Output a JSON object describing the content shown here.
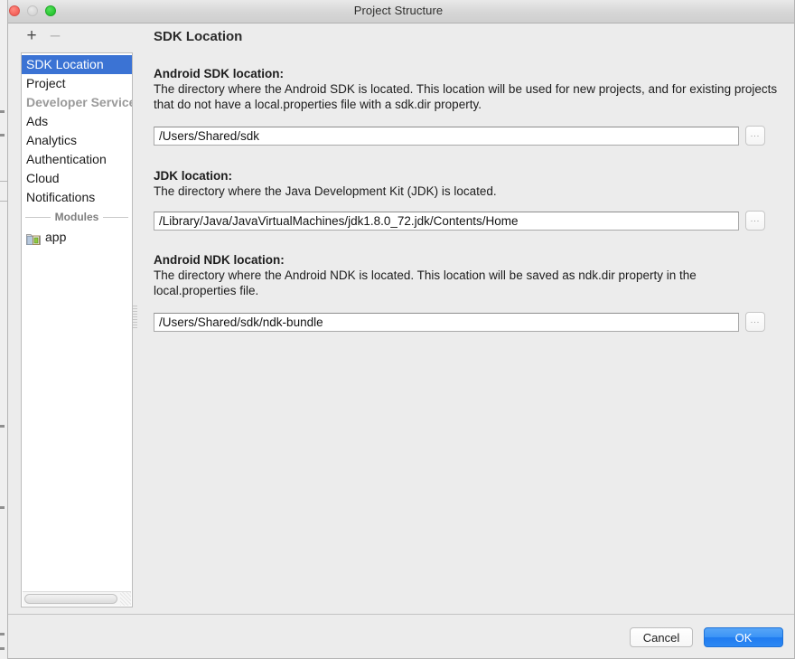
{
  "window": {
    "title": "Project Structure",
    "traffic_lights": [
      "close",
      "minimize",
      "zoom"
    ]
  },
  "sidebar": {
    "toolbar": {
      "add_label": "+",
      "remove_label": "–"
    },
    "items": [
      {
        "label": "SDK Location",
        "state": "selected"
      },
      {
        "label": "Project",
        "state": "normal"
      },
      {
        "label": "Developer Services",
        "state": "muted"
      },
      {
        "label": "Ads",
        "state": "normal"
      },
      {
        "label": "Analytics",
        "state": "normal"
      },
      {
        "label": "Authentication",
        "state": "normal"
      },
      {
        "label": "Cloud",
        "state": "normal"
      },
      {
        "label": "Notifications",
        "state": "normal"
      }
    ],
    "group_separator": "Modules",
    "modules": [
      {
        "label": "app",
        "icon": "android-module-icon"
      }
    ]
  },
  "content": {
    "title": "SDK Location",
    "sections": [
      {
        "label": "Android SDK location:",
        "description": "The directory where the Android SDK is located. This location will be used for new projects, and for existing projects that do not have a local.properties file with a sdk.dir property.",
        "value": "/Users/Shared/sdk",
        "placeholder": "",
        "browse_label": "..."
      },
      {
        "label": "JDK location:",
        "description": "The directory where the Java Development Kit (JDK) is located.",
        "value": "/Library/Java/JavaVirtualMachines/jdk1.8.0_72.jdk/Contents/Home",
        "placeholder": "",
        "browse_label": "..."
      },
      {
        "label": "Android NDK location:",
        "description": "The directory where the Android NDK is located. This location will be saved as ndk.dir property in the local.properties file.",
        "value": "/Users/Shared/sdk/ndk-bundle",
        "placeholder": "",
        "browse_label": "..."
      }
    ]
  },
  "footer": {
    "cancel_label": "Cancel",
    "ok_label": "OK"
  },
  "colors": {
    "selection_blue": "#3b73d4",
    "ok_button_blue": "#2c88f3",
    "window_chrome": "#ececec",
    "muted_text": "#9a9a9a"
  }
}
